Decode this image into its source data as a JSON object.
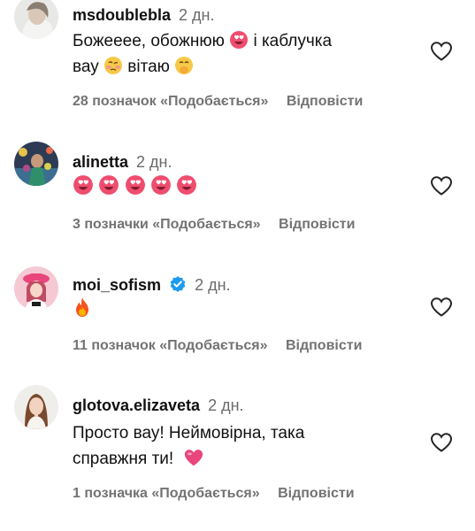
{
  "comments": [
    {
      "username": "msdoublebla",
      "time": "2 дн.",
      "text_line1": "Божееее, обожнюю",
      "text_line1_after": "і каблучка",
      "text_line2": "вау",
      "text_line2_after": "вітаю",
      "likes": "28 позначок «Подобається»",
      "reply": "Відповісти"
    },
    {
      "username": "alinetta",
      "time": "2 дн.",
      "likes": "3 позначки «Подобається»",
      "reply": "Відповісти"
    },
    {
      "username": "moi_sofism",
      "time": "2 дн.",
      "likes": "11 позначок «Подобається»",
      "reply": "Відповісти"
    },
    {
      "username": "glotova.elizaveta",
      "time": "2 дн.",
      "text_line1": "Просто вау! Неймовірна, така",
      "text_line2": "справжня ти!",
      "likes": "1 позначка «Подобається»",
      "reply": "Відповісти"
    }
  ],
  "icons": {
    "like": "heart-outline-icon",
    "verified": "verified-badge-icon",
    "emoji_heart_eyes": "heart-eyes-emoji",
    "emoji_fire": "fire-emoji",
    "emoji_pink_heart": "pink-heart-emoji"
  },
  "colors": {
    "text": "#111111",
    "muted": "#737373",
    "verified": "#1d9bf0",
    "heart_eyes_face": "#ef4d6e"
  }
}
